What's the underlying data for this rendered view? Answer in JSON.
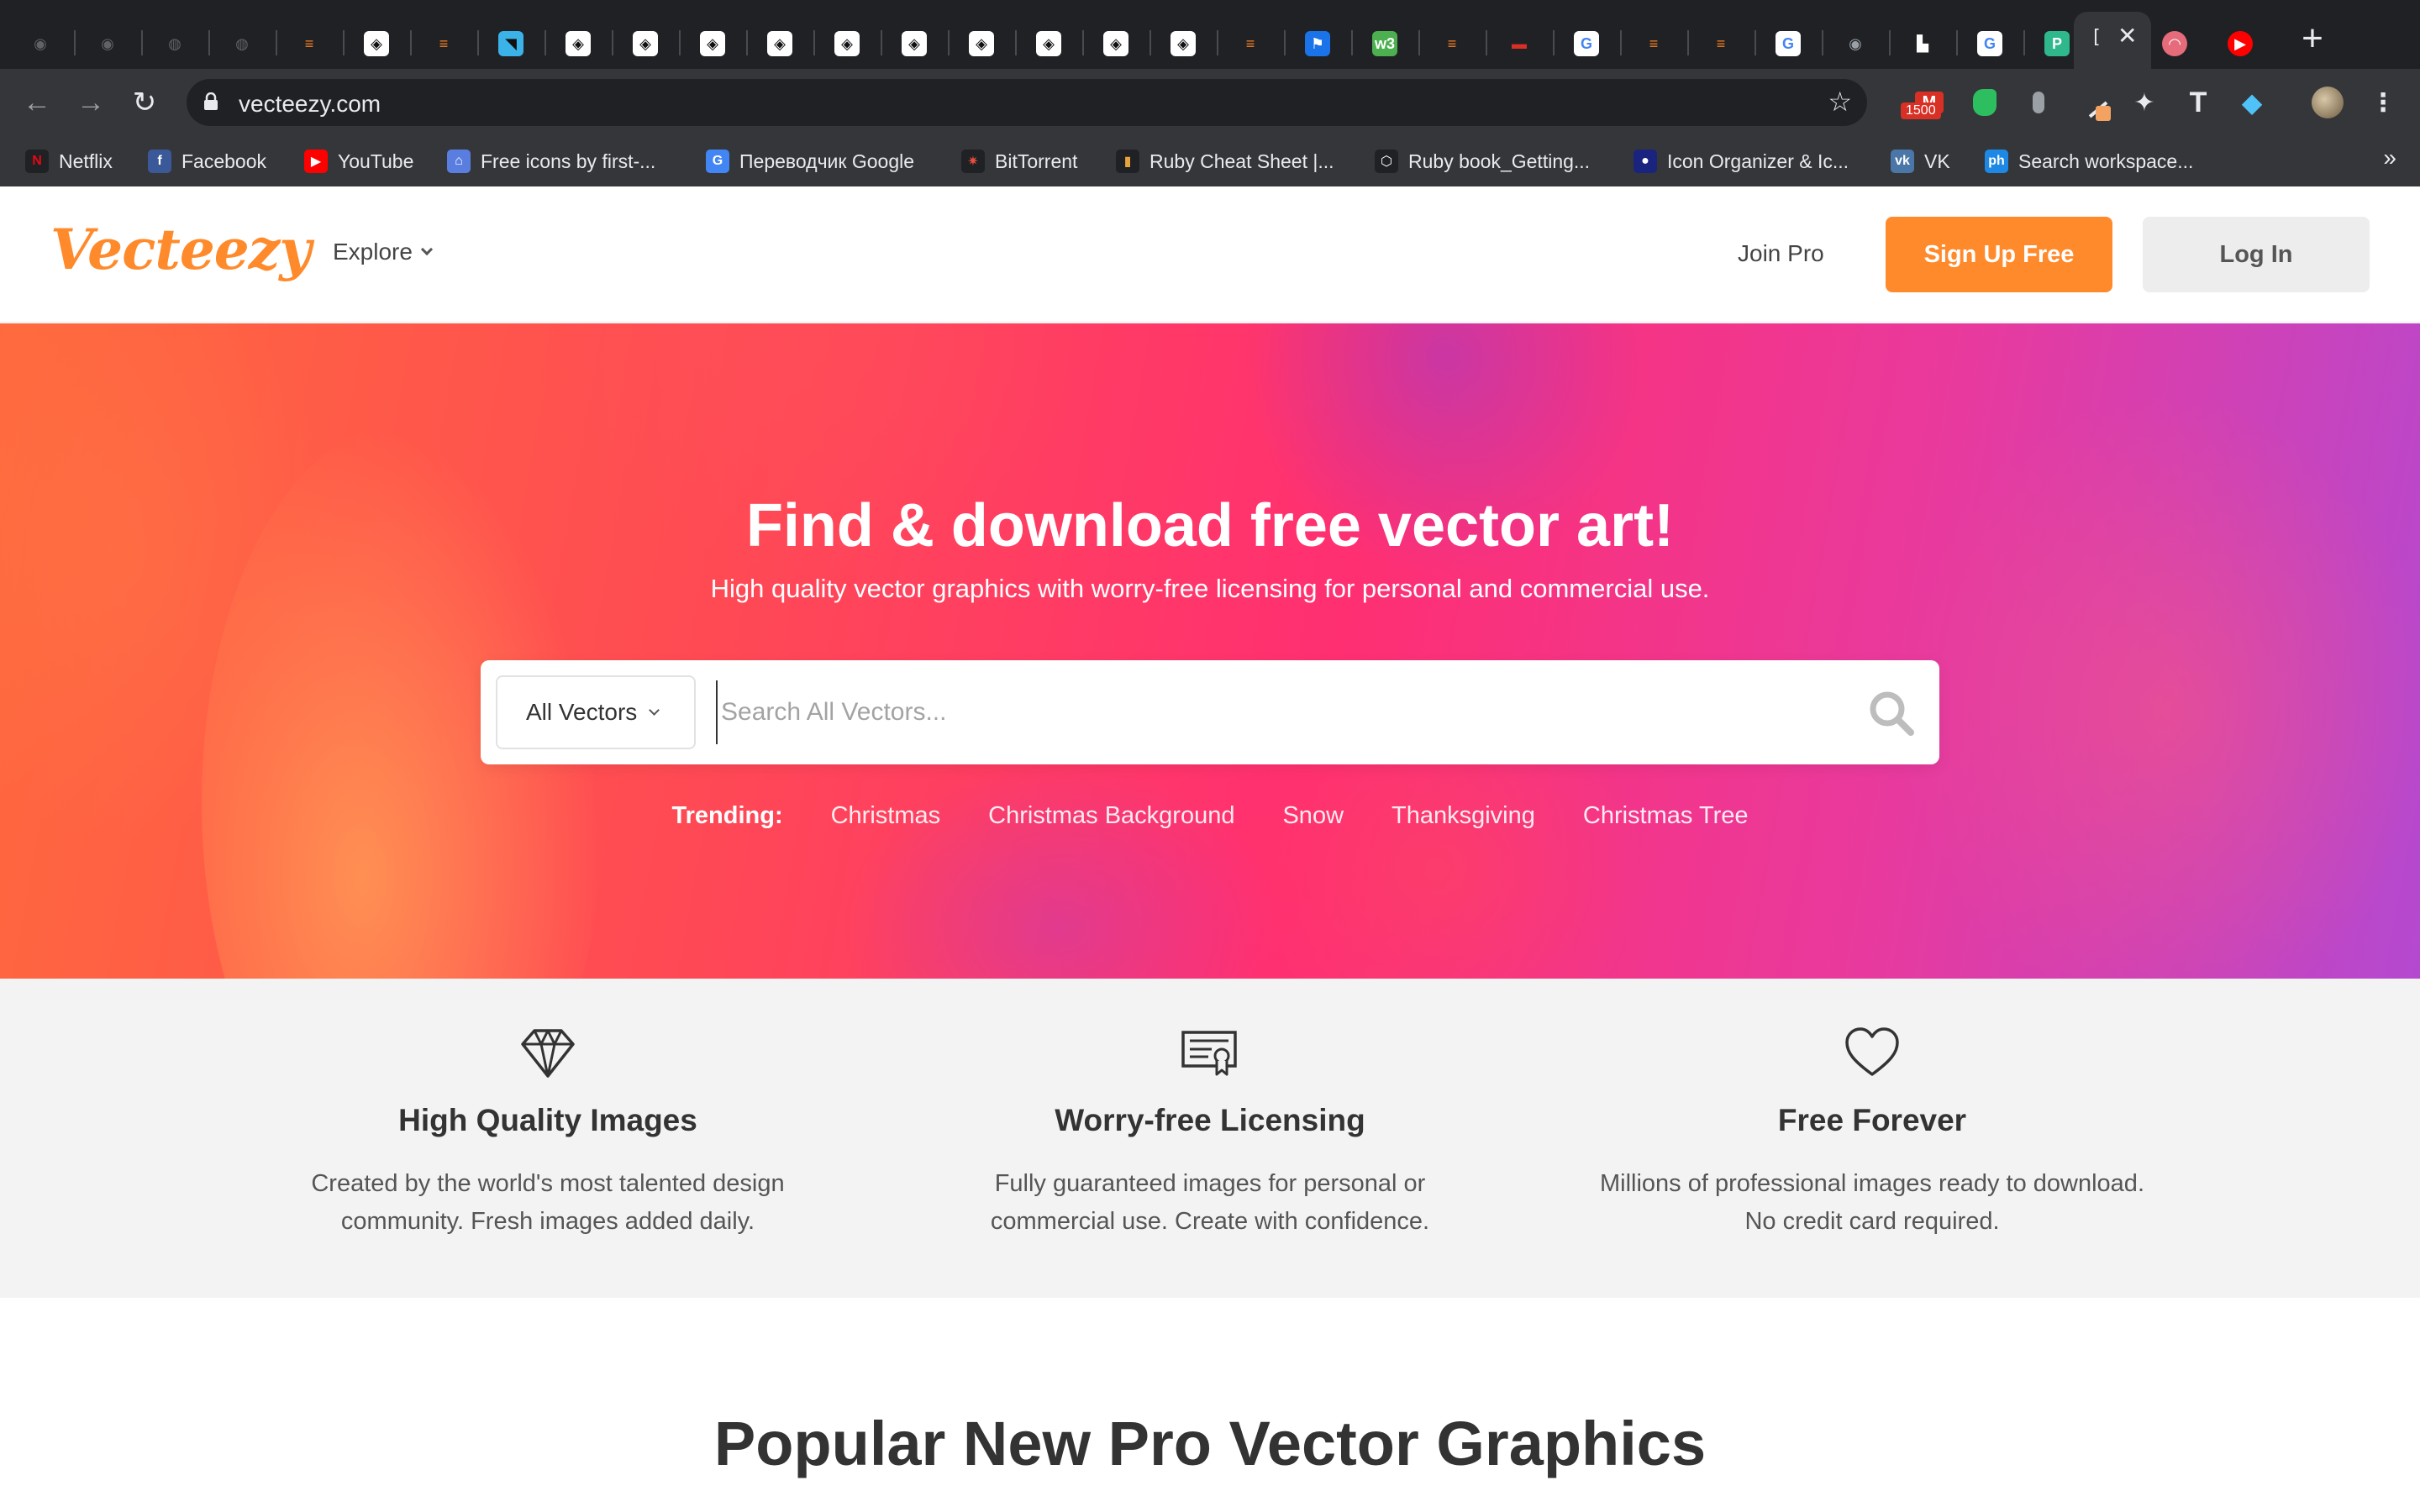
{
  "browser": {
    "tabs": [
      {
        "icon": "github-icon",
        "bg": "#202124",
        "fg": "#5f6368",
        "glyph": "◉"
      },
      {
        "icon": "github-icon",
        "bg": "#202124",
        "fg": "#5f6368",
        "glyph": "◉"
      },
      {
        "icon": "globe-icon",
        "bg": "#202124",
        "fg": "#5f6368",
        "glyph": "◍"
      },
      {
        "icon": "globe-icon",
        "bg": "#202124",
        "fg": "#5f6368",
        "glyph": "◍"
      },
      {
        "icon": "stackoverflow-icon",
        "bg": "#202124",
        "fg": "#f48024",
        "glyph": "≡"
      },
      {
        "icon": "codepen-icon",
        "bg": "#ffffff",
        "fg": "#111111",
        "glyph": "◈"
      },
      {
        "icon": "stackoverflow-icon",
        "bg": "#202124",
        "fg": "#f48024",
        "glyph": "≡"
      },
      {
        "icon": "chat-icon",
        "bg": "#3bb3e8",
        "fg": "#111111",
        "glyph": "◥"
      },
      {
        "icon": "codepen-icon",
        "bg": "#ffffff",
        "fg": "#111111",
        "glyph": "◈"
      },
      {
        "icon": "codepen-icon",
        "bg": "#ffffff",
        "fg": "#111111",
        "glyph": "◈"
      },
      {
        "icon": "codepen-icon",
        "bg": "#ffffff",
        "fg": "#111111",
        "glyph": "◈"
      },
      {
        "icon": "codepen-icon",
        "bg": "#ffffff",
        "fg": "#111111",
        "glyph": "◈"
      },
      {
        "icon": "codepen-icon",
        "bg": "#ffffff",
        "fg": "#111111",
        "glyph": "◈"
      },
      {
        "icon": "codepen-icon",
        "bg": "#ffffff",
        "fg": "#111111",
        "glyph": "◈"
      },
      {
        "icon": "codepen-icon",
        "bg": "#ffffff",
        "fg": "#111111",
        "glyph": "◈"
      },
      {
        "icon": "codepen-icon",
        "bg": "#ffffff",
        "fg": "#111111",
        "glyph": "◈"
      },
      {
        "icon": "codepen-icon",
        "bg": "#ffffff",
        "fg": "#111111",
        "glyph": "◈"
      },
      {
        "icon": "codepen-icon",
        "bg": "#ffffff",
        "fg": "#111111",
        "glyph": "◈"
      },
      {
        "icon": "stackoverflow-icon",
        "bg": "#202124",
        "fg": "#f48024",
        "glyph": "≡"
      },
      {
        "icon": "flag-icon",
        "bg": "#1a73e8",
        "fg": "#ffffff",
        "glyph": "⚑"
      },
      {
        "icon": "w3-icon",
        "bg": "#4caf50",
        "fg": "#ffffff",
        "glyph": "w3"
      },
      {
        "icon": "stackoverflow-icon",
        "bg": "#202124",
        "fg": "#f48024",
        "glyph": "≡"
      },
      {
        "icon": "car-icon",
        "bg": "#202124",
        "fg": "#d93025",
        "glyph": "▬"
      },
      {
        "icon": "google-icon",
        "bg": "#ffffff",
        "fg": "#4285f4",
        "glyph": "G"
      },
      {
        "icon": "stackoverflow-icon",
        "bg": "#202124",
        "fg": "#f48024",
        "glyph": "≡"
      },
      {
        "icon": "stackoverflow-icon",
        "bg": "#202124",
        "fg": "#f48024",
        "glyph": "≡"
      },
      {
        "icon": "google-icon",
        "bg": "#ffffff",
        "fg": "#4285f4",
        "glyph": "G"
      },
      {
        "icon": "github-icon",
        "bg": "#202124",
        "fg": "#9aa0a6",
        "glyph": "◉"
      },
      {
        "icon": "robot-icon",
        "bg": "#202124",
        "fg": "#ffffff",
        "glyph": "▙"
      },
      {
        "icon": "google-icon",
        "bg": "#ffffff",
        "fg": "#4285f4",
        "glyph": "G"
      },
      {
        "icon": "p-icon",
        "bg": "#2fb88b",
        "fg": "#ffffff",
        "glyph": "P"
      }
    ],
    "active_tab_close": "✕",
    "after_tabs": [
      {
        "icon": "mask-icon",
        "bg": "#e66b7b",
        "fg": "#ffffff",
        "glyph": "◠"
      },
      {
        "icon": "youtube-icon",
        "bg": "#ff0000",
        "fg": "#ffffff",
        "glyph": "▶"
      }
    ],
    "new_tab": "+",
    "url": "vecteezy.com",
    "gmail_badge": "1500",
    "bookmarks": [
      {
        "label": "Netflix",
        "icon": "netflix-icon",
        "bg": "#202124",
        "fg": "#e50914",
        "glyph": "N"
      },
      {
        "label": "Facebook",
        "icon": "facebook-icon",
        "bg": "#3b5998",
        "fg": "#ffffff",
        "glyph": "f"
      },
      {
        "label": "YouTube",
        "icon": "youtube-icon",
        "bg": "#ff0000",
        "fg": "#ffffff",
        "glyph": "▶"
      },
      {
        "label": "Free icons by first-...",
        "icon": "icons8-icon",
        "bg": "#5a7de0",
        "fg": "#ffffff",
        "glyph": "⌂"
      },
      {
        "label": "Переводчик Google",
        "icon": "translate-icon",
        "bg": "#4285f4",
        "fg": "#ffffff",
        "glyph": "G"
      },
      {
        "label": "BitTorrent",
        "icon": "bittorrent-icon",
        "bg": "#202124",
        "fg": "#e84d3d",
        "glyph": "✷"
      },
      {
        "label": "Ruby Cheat Sheet |...",
        "icon": "bars-icon",
        "bg": "#202124",
        "fg": "#e8a33d",
        "glyph": "▮"
      },
      {
        "label": "Ruby book_Getting...",
        "icon": "hexagon-icon",
        "bg": "#202124",
        "fg": "#ffffff",
        "glyph": "⬡"
      },
      {
        "label": "Icon Organizer & Ic...",
        "icon": "dot-icon",
        "bg": "#1a237e",
        "fg": "#ffffff",
        "glyph": "●"
      },
      {
        "label": "VK",
        "icon": "vk-icon",
        "bg": "#4a76a8",
        "fg": "#ffffff",
        "glyph": "vk"
      },
      {
        "label": "Search workspace...",
        "icon": "ph-icon",
        "bg": "#1e88e5",
        "fg": "#ffffff",
        "glyph": "ph"
      }
    ],
    "bookmarks_more": "»"
  },
  "header": {
    "logo": "Vecteezy",
    "explore": "Explore",
    "join_pro": "Join Pro",
    "sign_up": "Sign Up Free",
    "log_in": "Log In"
  },
  "hero": {
    "title": "Find & download free vector art!",
    "subtitle": "High quality vector graphics with worry-free licensing for personal and commercial use.",
    "search_category": "All Vectors",
    "search_placeholder": "Search All Vectors...",
    "trending_label": "Trending:",
    "trending": [
      "Christmas",
      "Christmas Background",
      "Snow",
      "Thanksgiving",
      "Christmas Tree"
    ]
  },
  "features": [
    {
      "icon": "diamond-icon",
      "title": "High Quality Images",
      "desc_line1": "Created by the world's most talented design",
      "desc_line2": "community. Fresh images added daily."
    },
    {
      "icon": "certificate-icon",
      "title": "Worry-free Licensing",
      "desc_line1": "Fully guaranteed images for personal or",
      "desc_line2": "commercial use. Create with confidence."
    },
    {
      "icon": "heart-icon",
      "title": "Free Forever",
      "desc_line1": "Millions of professional images ready to download.",
      "desc_line2": "No credit card required."
    }
  ],
  "popular_heading": "Popular New Pro Vector Graphics",
  "colors": {
    "brand_orange": "#ff8a2b",
    "chrome_dark": "#202124",
    "chrome_toolbar": "#35363a",
    "feature_bg": "#f3f3f3"
  }
}
